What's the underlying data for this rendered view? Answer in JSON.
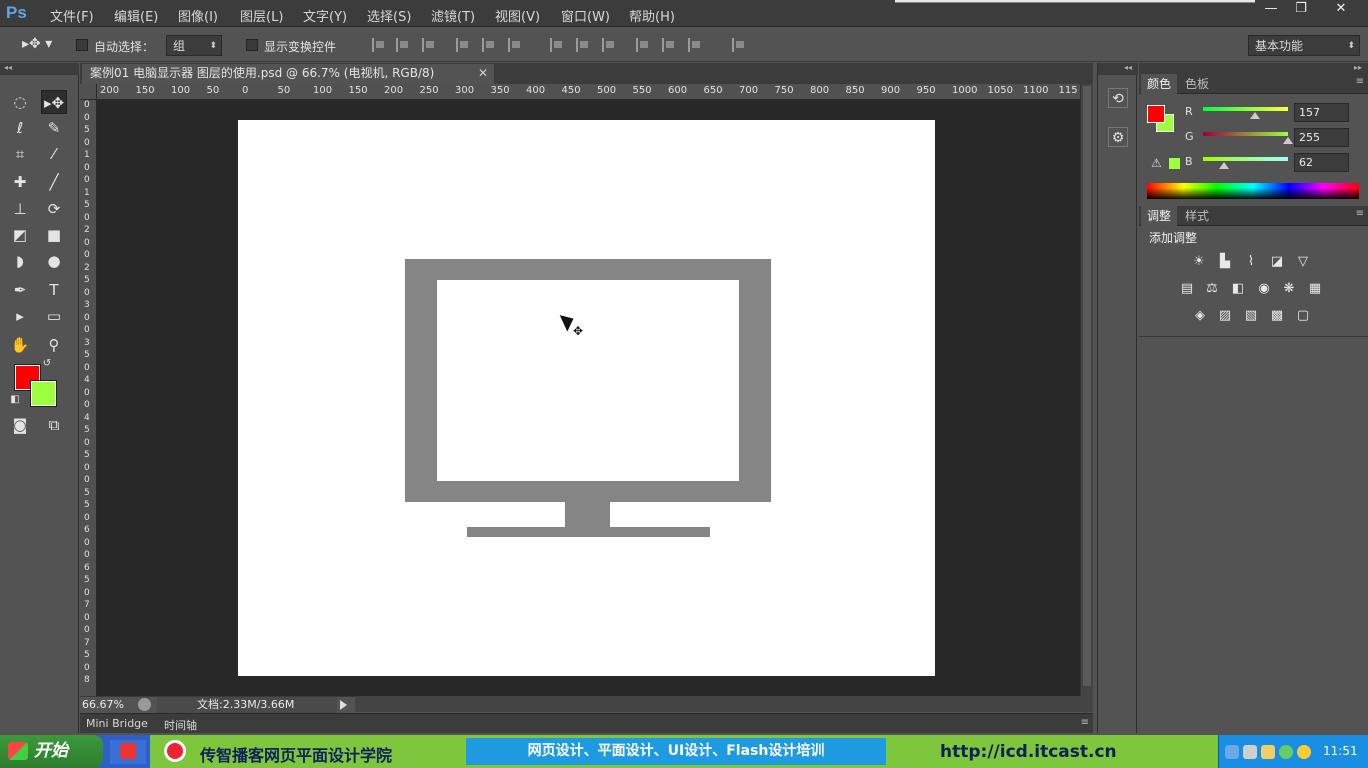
{
  "app": {
    "logo": "Ps",
    "menus": [
      "文件(F)",
      "编辑(E)",
      "图像(I)",
      "图层(L)",
      "文字(Y)",
      "选择(S)",
      "滤镜(T)",
      "视图(V)",
      "窗口(W)",
      "帮助(H)"
    ],
    "window_buttons": {
      "minimize": "—",
      "restore": "❐",
      "close": "✕"
    }
  },
  "options": {
    "auto_select_label": "自动选择：",
    "auto_select_value": "组",
    "show_transform_label": "显示变换控件",
    "workspace": "基本功能"
  },
  "document": {
    "tab_title": "案例01 电脑显示器 图层的使用.psd @ 66.7% (电视机, RGB/8)",
    "close_glyph": "✕",
    "ruler_top_labels": [
      "200",
      "150",
      "100",
      "50",
      "0",
      "50",
      "100",
      "150",
      "200",
      "250",
      "300",
      "350",
      "400",
      "450",
      "500",
      "550",
      "600",
      "650",
      "700",
      "750",
      "800",
      "850",
      "900",
      "950",
      "1000",
      "1050",
      "1100",
      "115"
    ],
    "ruler_left_labels": [
      "0",
      "0",
      "5",
      "0",
      "1",
      "0",
      "0",
      "1",
      "5",
      "0",
      "2",
      "0",
      "0",
      "2",
      "5",
      "0",
      "3",
      "0",
      "0",
      "3",
      "5",
      "0",
      "4",
      "0",
      "0",
      "4",
      "5",
      "0",
      "5",
      "0",
      "0",
      "5",
      "5",
      "0",
      "6",
      "0",
      "0",
      "6",
      "5",
      "0",
      "7",
      "0",
      "0",
      "7",
      "5",
      "0",
      "8"
    ]
  },
  "status": {
    "zoom": "66.67%",
    "doc_info": "文档:2.33M/3.66M"
  },
  "bottom_tabs": [
    "Mini Bridge",
    "时间轴"
  ],
  "color_panel": {
    "tabs": [
      "颜色",
      "色板"
    ],
    "channels": [
      {
        "label": "R",
        "value": "157",
        "fraction": 0.616
      },
      {
        "label": "G",
        "value": "255",
        "fraction": 1.0
      },
      {
        "label": "B",
        "value": "62",
        "fraction": 0.243
      }
    ],
    "foreground_color": "#ff0000",
    "background_color": "#9dff3e"
  },
  "adjust_panel": {
    "tabs": [
      "调整",
      "样式"
    ],
    "title": "添加调整"
  },
  "taskbar": {
    "start_label": "开始",
    "banner_name": "传智播客网页平面设计学院",
    "banner_courses": "网页设计、平面设计、UI设计、Flash设计培训",
    "banner_url": "http://icd.itcast.cn",
    "clock": "11:51"
  },
  "colors": {
    "monitor_gray": "#858585",
    "pasteboard": "#282828",
    "ui_bg": "#535353"
  }
}
